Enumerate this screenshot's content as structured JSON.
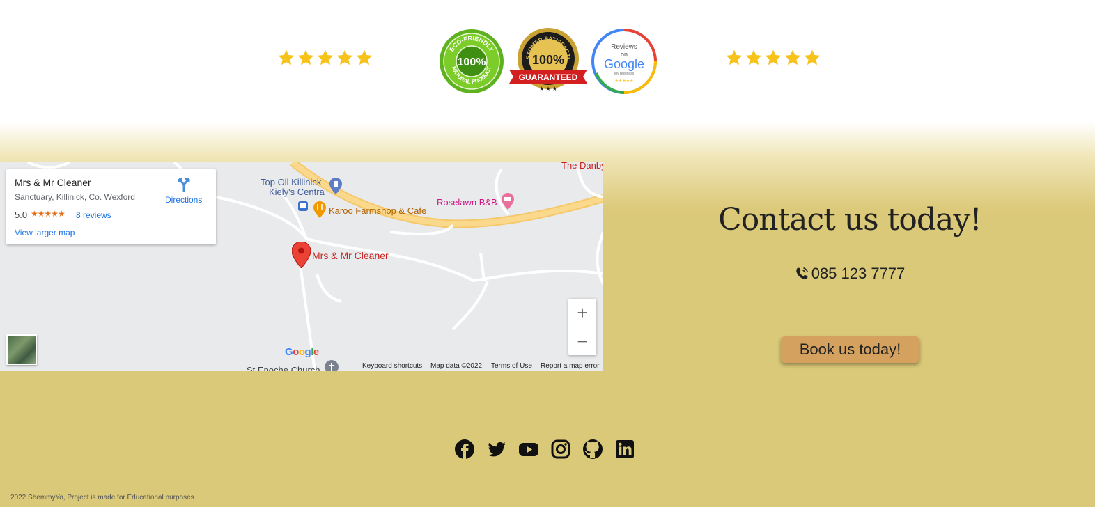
{
  "ratings": {
    "left_stars": 5,
    "right_stars": 5,
    "star_color": "#f7c21a"
  },
  "badges": {
    "eco": {
      "line1": "ECO-FRIENDLY",
      "big": "100%",
      "line2": "NATURAL PRODUCT"
    },
    "guaranteed": {
      "arc": "CUSTOMER SATISFACTION",
      "big": "100%",
      "ribbon": "GUARANTEED"
    },
    "google": {
      "line1": "Reviews",
      "line2": "on",
      "logo": "Google",
      "line3": "My Business"
    }
  },
  "map": {
    "card": {
      "name": "Mrs & Mr Cleaner",
      "address": "Sanctuary, Killinick, Co. Wexford",
      "rating": "5.0",
      "rating_stars": "★★★★★",
      "reviews": "8 reviews",
      "larger_map": "View larger map",
      "directions": "Directions"
    },
    "places": {
      "danby": "The Danby",
      "topoil_1": "Top Oil Killinick",
      "topoil_2": "Kiely's Centra",
      "karoo": "Karoo Farmshop & Cafe",
      "roselawn": "Roselawn B&B",
      "marker": "Mrs & Mr Cleaner",
      "church": "St Enoche Church"
    },
    "google_logo": "Google",
    "attribution": {
      "shortcuts": "Keyboard shortcuts",
      "mapdata": "Map data ©2022",
      "terms": "Terms of Use",
      "report": "Report a map error"
    },
    "zoom_in": "+",
    "zoom_out": "−"
  },
  "contact": {
    "title": "Contact us today!",
    "phone": "085 123 7777",
    "book_button": "Book us today!"
  },
  "socials": [
    "facebook",
    "twitter",
    "youtube",
    "instagram",
    "github",
    "linkedin"
  ],
  "footer": "2022 ShemmyYo, Project is made for Educational purposes"
}
